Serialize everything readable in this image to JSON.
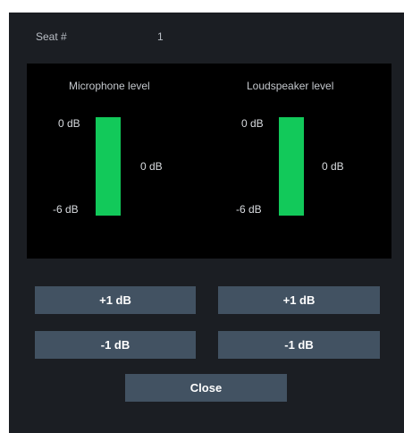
{
  "seat": {
    "label": "Seat #",
    "value": "1"
  },
  "microphone": {
    "title": "Microphone level",
    "top_label": "0 dB",
    "bottom_label": "-6 dB",
    "current_label": "0 dB",
    "level_fraction": 1.0
  },
  "loudspeaker": {
    "title": "Loudspeaker level",
    "top_label": "0 dB",
    "bottom_label": "-6 dB",
    "current_label": "0 dB",
    "level_fraction": 1.0
  },
  "buttons": {
    "mic_plus": "+1 dB",
    "spk_plus": "+1 dB",
    "mic_minus": "-1 dB",
    "spk_minus": "-1 dB",
    "close": "Close"
  },
  "colors": {
    "dialog_bg": "#1b1e23",
    "meter_fill": "#12c95a",
    "button_bg": "#425262"
  }
}
